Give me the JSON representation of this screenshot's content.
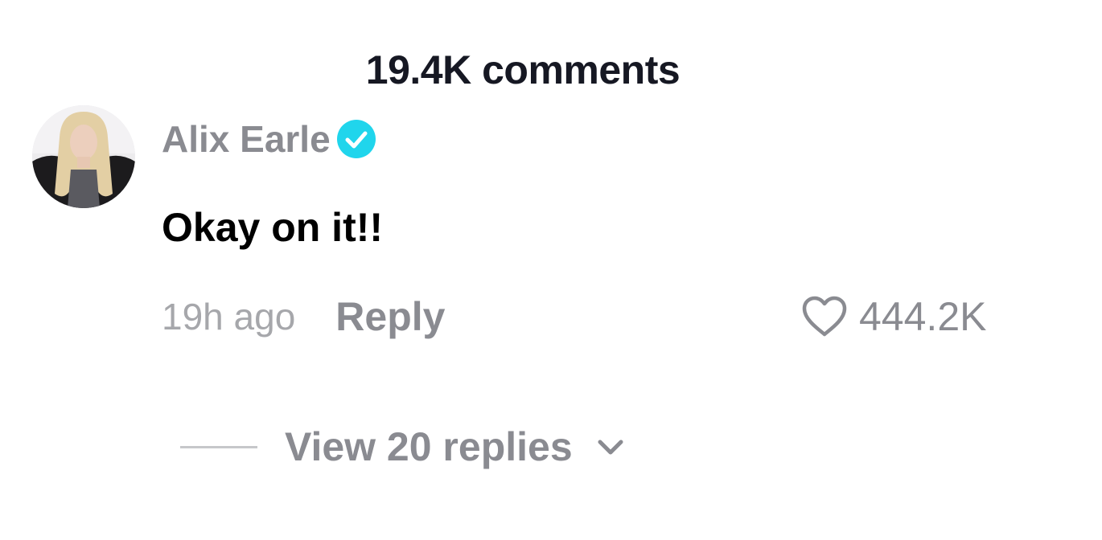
{
  "header": {
    "title": "19.4K comments"
  },
  "comment": {
    "avatar_icon": "user-avatar-photo",
    "username": "Alix Earle",
    "verified_icon": "verified-badge-icon",
    "verified_color": "#20D5EC",
    "text": "Okay on it!!",
    "timestamp": "19h ago",
    "reply_label": "Reply",
    "like_icon": "heart-outline-icon",
    "like_count": "444.2K"
  },
  "replies": {
    "label": "View 20 replies",
    "chevron_icon": "chevron-down-icon"
  },
  "colors": {
    "title": "#161823",
    "username": "#8A8B91",
    "comment_text": "#000000",
    "muted": "#A6A7AB",
    "action": "#8A8B91"
  }
}
